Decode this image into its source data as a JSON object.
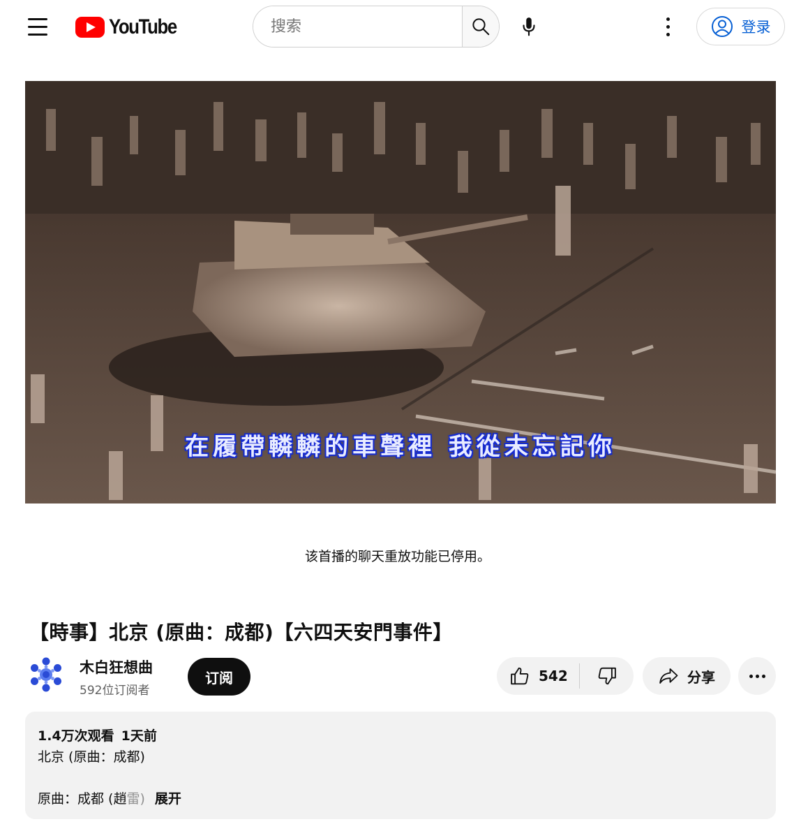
{
  "header": {
    "logo_text": "YouTube",
    "search_placeholder": "搜索",
    "signin_label": "登录"
  },
  "video": {
    "subtitle": "在履帶轔轔的車聲裡 我從未忘記你"
  },
  "chat": {
    "notice": "该首播的聊天重放功能已停用。"
  },
  "title": "【時事】北京 (原曲：成都)【六四天安門事件】",
  "channel": {
    "name": "木白狂想曲",
    "subscribers": "592位订阅者",
    "subscribe_label": "订阅"
  },
  "actions": {
    "likes": "542",
    "share_label": "分享"
  },
  "description": {
    "views": "1.4万次观看",
    "date": "1天前",
    "line1": "北京 (原曲：成都)",
    "line2_text": "原曲：成都 (趙",
    "line2_fade": "雷)",
    "expand_label": "展开"
  },
  "colors": {
    "brand_red": "#ff0000",
    "signin_blue": "#065fd4",
    "subscribe_bg": "#0f0f0f",
    "pill_bg": "#f2f2f2",
    "avatar_blue": "#2a4bd6",
    "subtitle_blue": "#1a28d8"
  },
  "icons": {
    "menu": "hamburger-menu-icon",
    "search": "search-icon",
    "mic": "microphone-icon",
    "more": "more-vertical-icon",
    "account": "account-circle-icon",
    "like": "thumbs-up-icon",
    "dislike": "thumbs-down-icon",
    "share": "share-arrow-icon",
    "more_actions": "more-horizontal-icon"
  }
}
